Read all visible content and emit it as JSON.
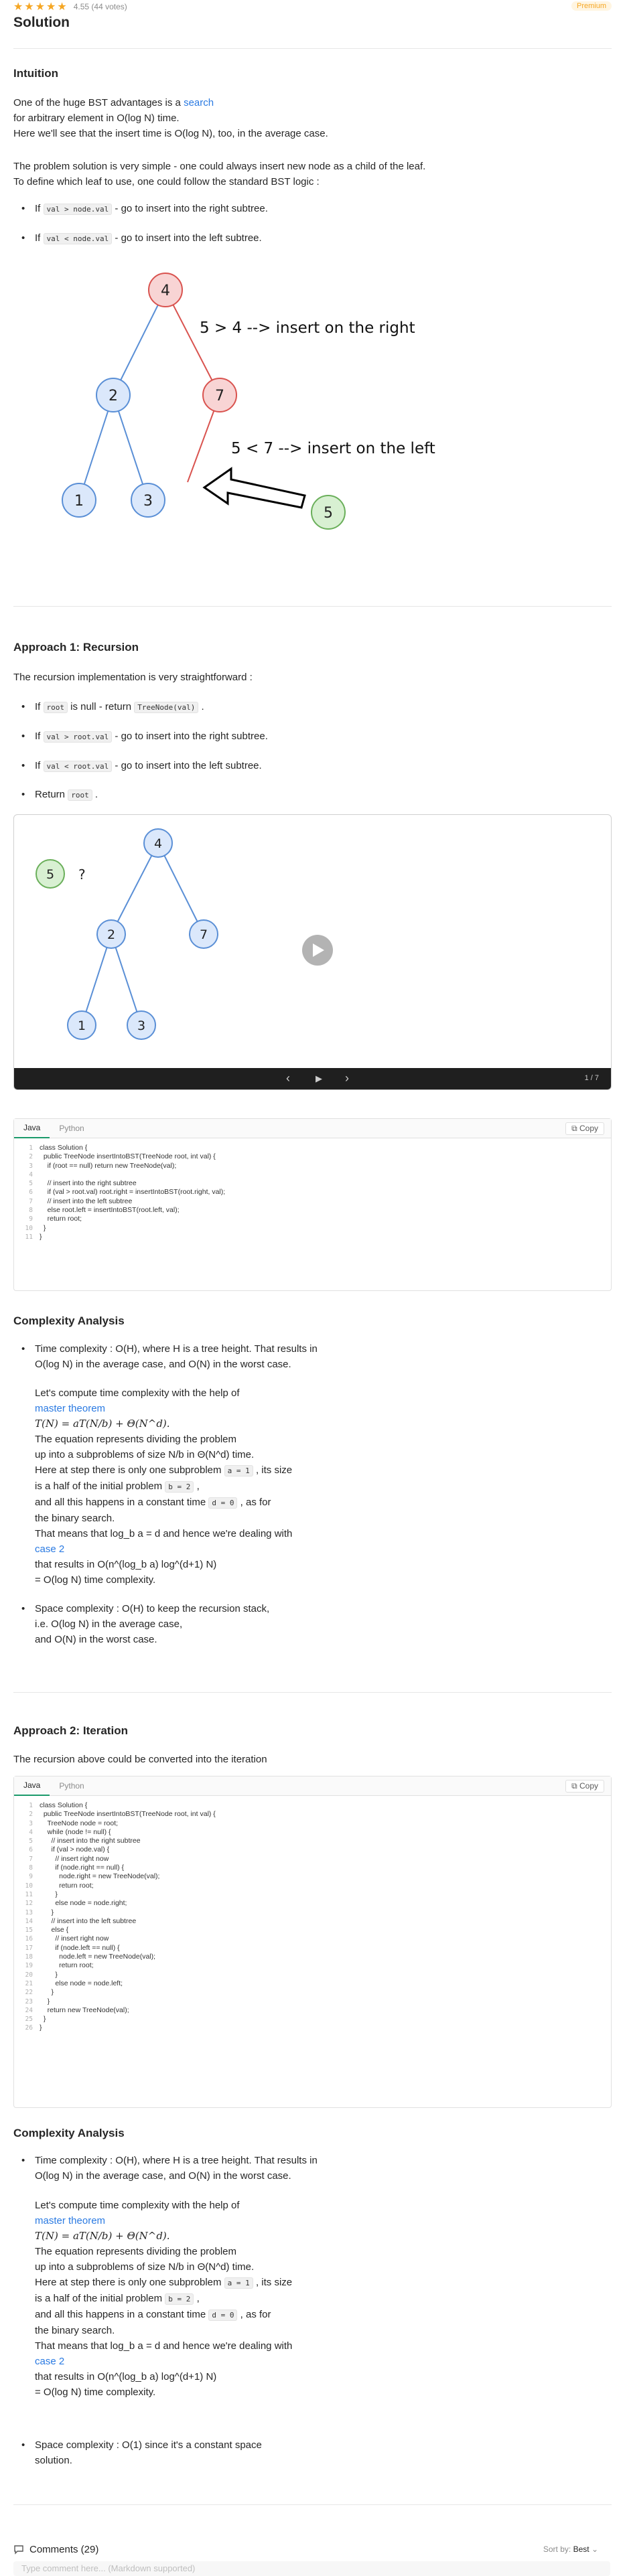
{
  "header": {
    "stars": "★★★★★",
    "rating": "4.55 (44 votes)",
    "premium": "Premium",
    "title": "Solution"
  },
  "intuition": {
    "heading": "Intuition",
    "p1_a": "One of the huge BST advantages is a ",
    "p1_link": "search",
    "p1_b": "for arbitrary element in O(log N) time.",
    "p1_c": "Here we'll see that the insert time is O(log N), too, in the average case.",
    "p2_a": "The problem solution is very simple - one could always insert new node as a child of the leaf.",
    "p2_b": "To define which leaf to use, one could follow the standard BST logic :",
    "b1_code": "val > node.val",
    "b1_text": " - go to insert into the right subtree.",
    "b2_code": "val < node.val",
    "b2_text": " - go to insert into the left subtree.",
    "b_prefix": "If "
  },
  "tree1": {
    "nodes": [
      "4",
      "2",
      "7",
      "1",
      "3",
      "5"
    ],
    "label_right": "5 > 4 --> insert on the right",
    "label_left": "5 < 7 --> insert on the left"
  },
  "approach1": {
    "heading": "Approach 1: Recursion",
    "intro": "The recursion implementation is very straightforward :",
    "b1_pre": "If ",
    "b1_code": "root",
    "b1_mid": " is null - return ",
    "b1_code2": "TreeNode(val)",
    "b1_end": " .",
    "b2_code": "val > root.val",
    "b2_text": " - go to insert into the right subtree.",
    "b3_code": "val < root.val",
    "b3_text": " - go to insert into the left subtree.",
    "b4_pre": "Return ",
    "b4_code": "root",
    "b4_end": " ."
  },
  "slideshow": {
    "nodes": [
      "4",
      "2",
      "7",
      "1",
      "3"
    ],
    "new_node": "5",
    "question": "?",
    "counter": "1 / 7",
    "prev": "‹",
    "play": "▶",
    "next": "›"
  },
  "code1": {
    "tabs": [
      "Java",
      "Python"
    ],
    "copy": "Copy",
    "lines": [
      "class Solution {",
      "  public TreeNode insertIntoBST(TreeNode root, int val) {",
      "    if (root == null) return new TreeNode(val);",
      "",
      "    // insert into the right subtree",
      "    if (val > root.val) root.right = insertIntoBST(root.right, val);",
      "    // insert into the left subtree",
      "    else root.left = insertIntoBST(root.left, val);",
      "    return root;",
      "  }",
      "}"
    ]
  },
  "complexity1": {
    "heading": "Complexity Analysis",
    "t1": "Time complexity : O(H), where H is a tree height. That results in",
    "t2": "O(log N) in the average case, and O(N) in the worst case.",
    "t3": "Let's compute time complexity with the help of",
    "t4": "master theorem",
    "t5": "T(N) = aT(N/b) + Θ(N^d).",
    "t6": "The equation represents dividing the problem",
    "t7a": "up into a subproblems of size N/b in Θ(N^d) time.",
    "t8a": "Here at step there is only one subproblem ",
    "t8code": "a = 1",
    "t8b": " , its size",
    "t9a": "is a half of the initial problem ",
    "t9code": "b = 2",
    "t9b": " ,",
    "t10a": "and all this happens in a constant time ",
    "t10code": "d = 0",
    "t10b": " , as for",
    "t11": "the binary search.",
    "t12": "That means that log_b a = d and hence we're dealing with",
    "t13": "case 2",
    "t14": "that results in O(n^(log_b a) log^(d+1) N)",
    "t15": "= O(log N) time complexity.",
    "s1": "Space complexity : O(H) to keep the recursion stack,",
    "s2": "i.e. O(log N) in the average case,",
    "s3": "and O(N) in the worst case."
  },
  "approach2": {
    "heading": "Approach 2: Iteration",
    "intro": "The recursion above could be converted into the iteration"
  },
  "code2": {
    "tabs": [
      "Java",
      "Python"
    ],
    "copy": "Copy",
    "lines": [
      "class Solution {",
      "  public TreeNode insertIntoBST(TreeNode root, int val) {",
      "    TreeNode node = root;",
      "    while (node != null) {",
      "      // insert into the right subtree",
      "      if (val > node.val) {",
      "        // insert right now",
      "        if (node.right == null) {",
      "          node.right = new TreeNode(val);",
      "          return root;",
      "        }",
      "        else node = node.right;",
      "      }",
      "      // insert into the left subtree",
      "      else {",
      "        // insert right now",
      "        if (node.left == null) {",
      "          node.left = new TreeNode(val);",
      "          return root;",
      "        }",
      "        else node = node.left;",
      "      }",
      "    }",
      "    return new TreeNode(val);",
      "  }",
      "}"
    ]
  },
  "complexity2": {
    "heading": "Complexity Analysis",
    "t1": "Time complexity : O(H), where H is a tree height. That results in",
    "t2": "O(log N) in the average case, and O(N) in the worst case.",
    "t3": "Let's compute time complexity with the help of",
    "t4": "master theorem",
    "t5": "T(N) = aT(N/b) + Θ(N^d).",
    "t6": "The equation represents dividing the problem",
    "t7a": "up into a subproblems of size N/b in Θ(N^d) time.",
    "t8a": "Here at step there is only one subproblem ",
    "t8code": "a = 1",
    "t8b": " , its size",
    "t9a": "is a half of the initial problem ",
    "t9code": "b = 2",
    "t9b": " ,",
    "t10a": "and all this happens in a constant time ",
    "t10code": "d = 0",
    "t10b": " , as for",
    "t11": "the binary search.",
    "t12": "That means that log_b a = d and hence we're dealing with",
    "t13": "case 2",
    "t14": "that results in O(n^(log_b a) log^(d+1) N)",
    "t15": "= O(log N) time complexity.",
    "s1": "Space complexity : O(1) since it's a constant space",
    "s2": "solution."
  },
  "comments": {
    "title": "Comments (29)",
    "sort_label": "Sort by:",
    "sort_value": "Best",
    "placeholder": "Type comment here... (Markdown supported)"
  },
  "colors": {
    "node_blue_fill": "#dbe8fb",
    "node_blue_stroke": "#5a8fd6",
    "node_red_fill": "#f8d4d4",
    "node_red_stroke": "#d9534f",
    "node_green_fill": "#d8f0d2",
    "node_green_stroke": "#6aaf5a",
    "link": "#2a7ae2",
    "star": "#f5a623"
  }
}
